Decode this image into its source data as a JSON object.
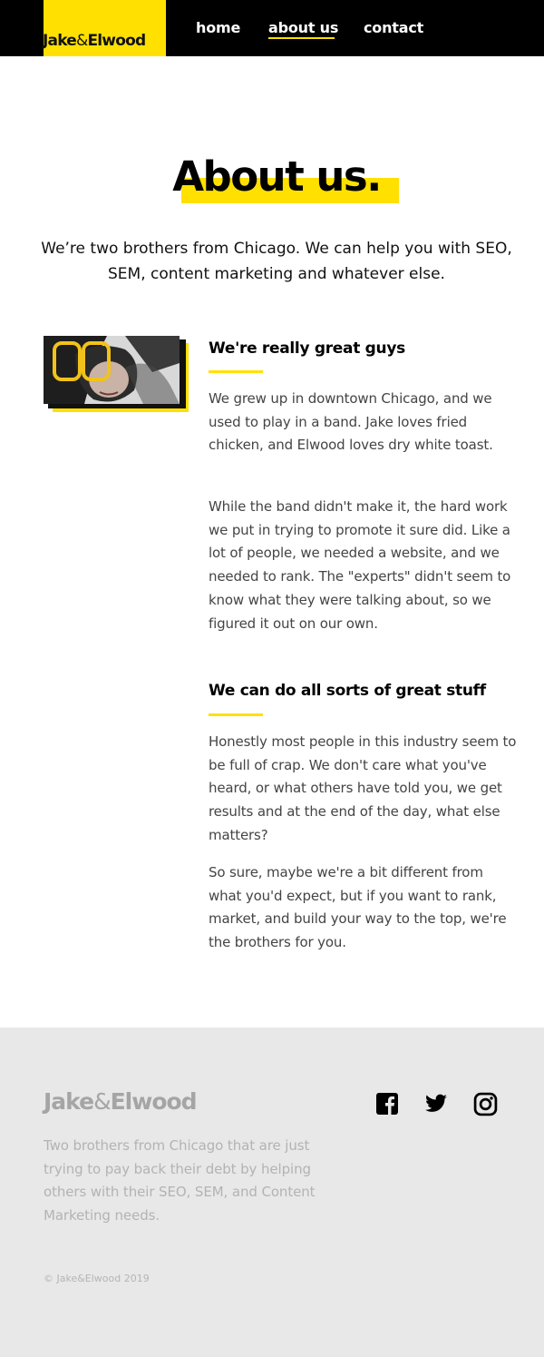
{
  "header": {
    "logo": {
      "part1": "Jake",
      "amp": "&",
      "part2": "Elwood"
    },
    "nav": [
      {
        "label": "home"
      },
      {
        "label": "about us",
        "active": true
      },
      {
        "label": "contact"
      }
    ]
  },
  "hero": {
    "title": "About us.",
    "intro": "We’re two brothers from Chicago. We can help you with SEO, SEM, content marketing and whatever else."
  },
  "sections": [
    {
      "title": "We're really great guys",
      "paragraphs": [
        "We grew up in downtown Chicago, and we used to play in a band. Jake loves fried chicken, and Elwood loves dry white toast.",
        "While the band didn't make it, the hard work we put in trying to promote it sure did. Like a lot of people, we needed a website, and we needed to rank. The \"experts\" didn't seem to know what they were talking about, so we figured it out on our own."
      ]
    },
    {
      "title": "We can do all sorts of great stuff",
      "paragraphs": [
        "Honestly most people in this industry seem to be full of crap. We don't care what you've heard, or what others have told you, we get results and at the end of the day, what else matters?",
        "So sure, maybe we're a bit different from what you'd expect, but if you want to rank, market, and build your way to the top, we're the brothers for you."
      ]
    }
  ],
  "footer": {
    "logo": {
      "part1": "Jake",
      "amp": "&",
      "part2": "Elwood"
    },
    "description": "Two brothers from Chicago that are just trying to pay back their debt by helping others with their SEO, SEM, and Content Marketing needs.",
    "copyright": "© Jake&Elwood 2019",
    "social_icons": [
      "facebook-icon",
      "twitter-icon",
      "instagram-icon"
    ]
  },
  "colors": {
    "accent": "#ffe000",
    "header_bg": "#000000",
    "footer_bg": "#e8e8e8"
  }
}
